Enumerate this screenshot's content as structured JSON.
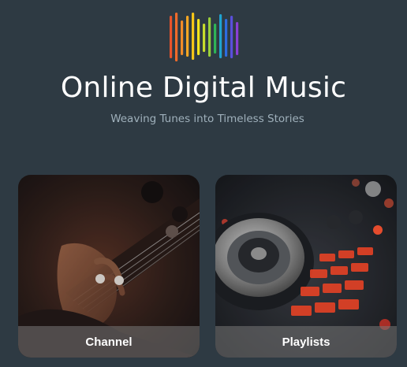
{
  "header": {
    "logo_icon": "equalizer-bars-logo",
    "title": "Online Digital Music",
    "subtitle": "Weaving Tunes into Timeless Stories"
  },
  "cards": [
    {
      "label": "Channel",
      "image": "bass-guitar-strings-photo"
    },
    {
      "label": "Playlists",
      "image": "dj-controller-turntable-photo"
    }
  ],
  "colors": {
    "background": "#2e3a43",
    "subtitle": "#9fb0bb",
    "logo_bars": [
      "#e8532b",
      "#f28c28",
      "#f5c518",
      "#f2e31c",
      "#9ad03a",
      "#2fb457",
      "#1fa3d1",
      "#2d6ce0",
      "#8a3fd6"
    ]
  }
}
